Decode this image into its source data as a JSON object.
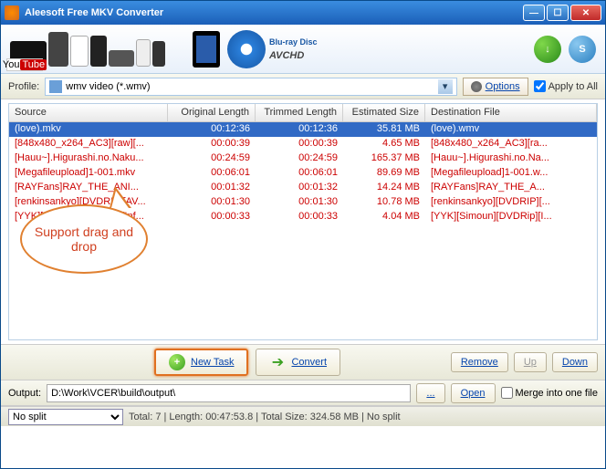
{
  "window": {
    "title": "Aleesoft Free MKV Converter"
  },
  "banner": {
    "youtube_you": "You",
    "youtube_tube": "Tube",
    "bluray": "Blu-ray Disc",
    "avchd": "AVCHD",
    "download_icon": "↓",
    "s_label": "S"
  },
  "profile": {
    "label": "Profile:",
    "value": "wmv video (*.wmv)",
    "options_btn": "Options",
    "apply_all": "Apply to All"
  },
  "table": {
    "headers": {
      "source": "Source",
      "orig": "Original Length",
      "trim": "Trimmed Length",
      "size": "Estimated Size",
      "dest": "Destination File"
    },
    "rows": [
      {
        "source": "(love).mkv",
        "orig": "00:12:36",
        "trim": "00:12:36",
        "size": "35.81 MB",
        "dest": "(love).wmv",
        "sel": true
      },
      {
        "source": "[848x480_x264_AC3][raw][...",
        "orig": "00:00:39",
        "trim": "00:00:39",
        "size": "4.65 MB",
        "dest": "[848x480_x264_AC3][ra..."
      },
      {
        "source": "[Hauu~].Higurashi.no.Naku...",
        "orig": "00:24:59",
        "trim": "00:24:59",
        "size": "165.37 MB",
        "dest": "[Hauu~].Higurashi.no.Na..."
      },
      {
        "source": "[Megafileupload]1-001.mkv",
        "orig": "00:06:01",
        "trim": "00:06:01",
        "size": "89.69 MB",
        "dest": "[Megafileupload]1-001.w..."
      },
      {
        "source": "[RAYFans]RAY_THE_ANI...",
        "orig": "00:01:32",
        "trim": "00:01:32",
        "size": "14.24 MB",
        "dest": "[RAYFans]RAY_THE_A..."
      },
      {
        "source": "[renkinsankyo][DVDRIP][AV...",
        "orig": "00:01:30",
        "trim": "00:01:30",
        "size": "10.78 MB",
        "dest": "[renkinsankyo][DVDRIP][..."
      },
      {
        "source": "[YYK][Simoun][DVDRip][Inf...",
        "orig": "00:00:33",
        "trim": "00:00:33",
        "size": "4.04 MB",
        "dest": "[YYK][Simoun][DVDRip][I..."
      }
    ]
  },
  "callout": "Support drag and drop",
  "actions": {
    "new_task": "New Task",
    "convert": "Convert",
    "remove": "Remove",
    "up": "Up",
    "down": "Down"
  },
  "output": {
    "label": "Output:",
    "path": "D:\\Work\\VCER\\build\\output\\",
    "browse": "...",
    "open": "Open",
    "merge": "Merge into one file"
  },
  "status": {
    "split": "No split",
    "text": "Total: 7 | Length: 00:47:53.8 | Total Size: 324.58 MB | No split"
  }
}
